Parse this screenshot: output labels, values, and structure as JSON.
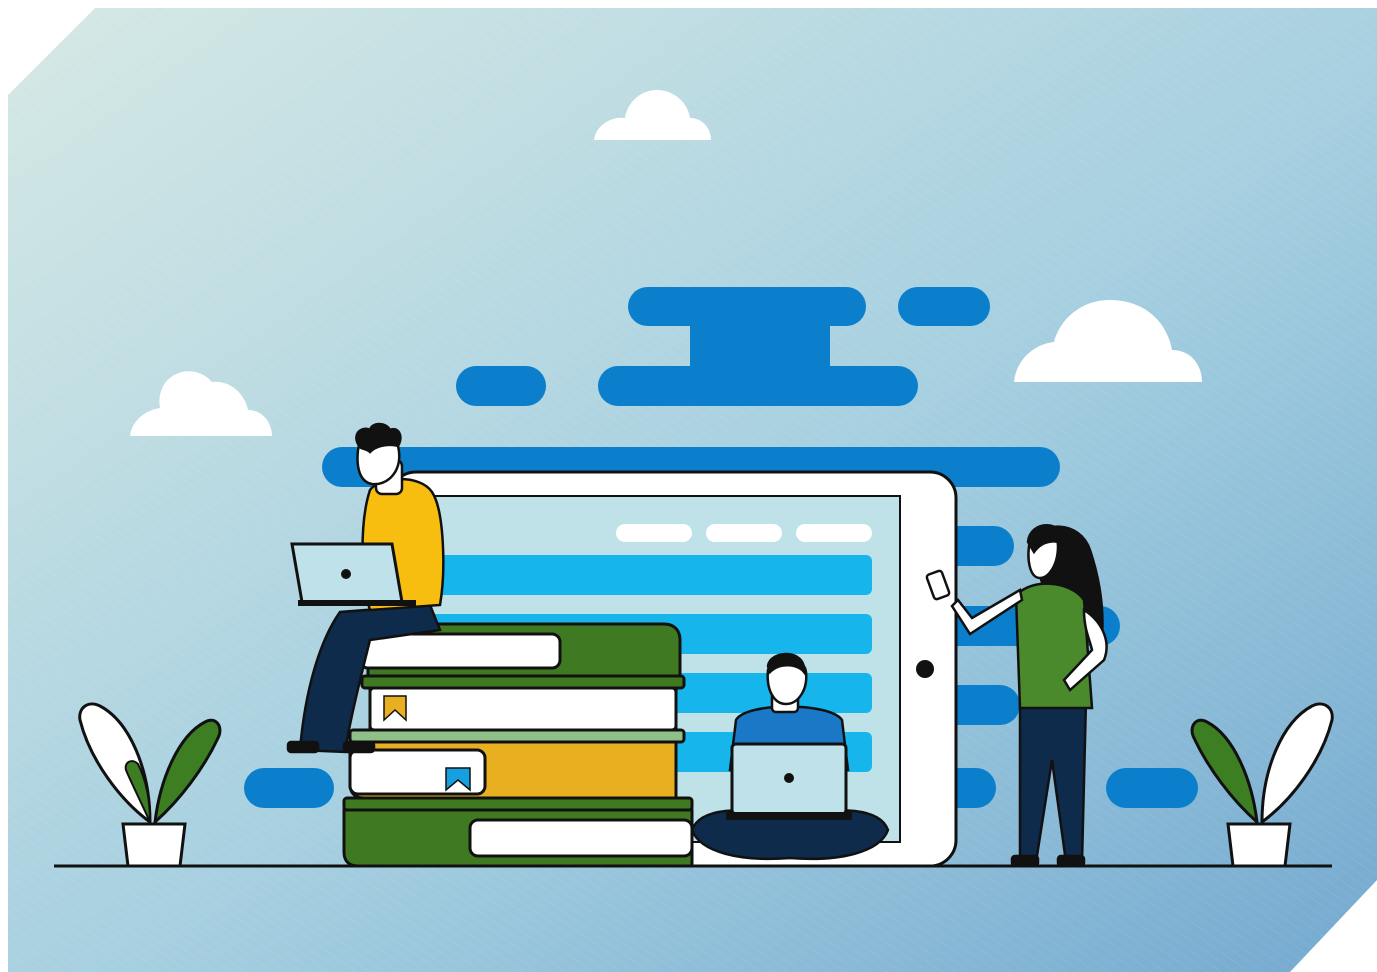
{
  "colors": {
    "background_start": "#d2e6e3",
    "background_end": "#7aafd0",
    "cloud": "#ffffff",
    "stripe_blue": "#0b7fcc",
    "tablet_screen": "#bfe2e8",
    "tablet_row": "#16b6ec",
    "book_green": "#3f7a22",
    "book_yellow": "#e8b021",
    "shirt_yellow": "#f7be10",
    "shirt_blue": "#1b78c6",
    "shirt_green": "#4a8a2c",
    "pants_navy": "#0e2b4c",
    "hair": "#111111",
    "plant_leaf": "#3d7e22",
    "laptop_screen": "#bfe2ea",
    "outline": "#111111"
  },
  "scene": {
    "description_name": "online-learning-illustration",
    "people": [
      "person-on-books-with-laptop",
      "person-sitting-with-laptop",
      "woman-with-phone"
    ]
  }
}
